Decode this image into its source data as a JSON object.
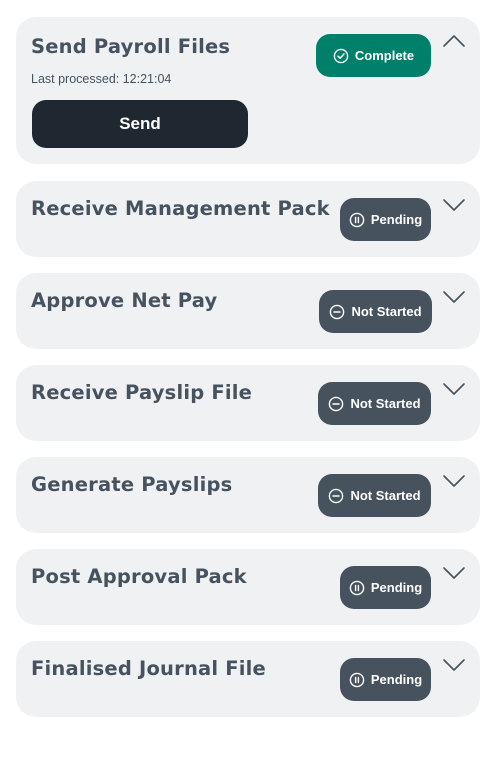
{
  "steps": [
    {
      "title": "Send Payroll Files",
      "status": "Complete",
      "status_icon": "check-circle-icon",
      "expanded": true,
      "last_processed_label": "Last processed: 12:21:04",
      "action_label": "Send"
    },
    {
      "title": "Receive Management Pack",
      "status": "Pending",
      "status_icon": "pause-circle-icon",
      "expanded": false
    },
    {
      "title": "Approve Net Pay",
      "status": "Not Started",
      "status_icon": "minus-circle-icon",
      "expanded": false
    },
    {
      "title": "Receive Payslip File",
      "status": "Not Started",
      "status_icon": "minus-circle-icon",
      "expanded": false
    },
    {
      "title": "Generate Payslips",
      "status": "Not Started",
      "status_icon": "minus-circle-icon",
      "expanded": false
    },
    {
      "title": "Post Approval Pack",
      "status": "Pending",
      "status_icon": "pause-circle-icon",
      "expanded": false
    },
    {
      "title": "Finalised Journal File",
      "status": "Pending",
      "status_icon": "pause-circle-icon",
      "expanded": false
    }
  ],
  "colors": {
    "card_bg": "#f0f1f3",
    "title_text": "#46535f",
    "complete": "#00806a",
    "pending": "#46535f",
    "not_started": "#46535f",
    "send_button": "#1f2730"
  }
}
